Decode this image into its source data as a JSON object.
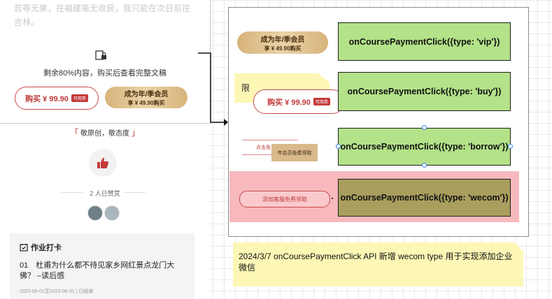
{
  "app": {
    "faded_text": "苦等无果，在福建毫无收获，我只能在次日前往吉林。",
    "remaining_text": "剩余80%内容，购买后查看完整文稿",
    "buy_button": {
      "label": "购买 ¥ 99.90",
      "coupon": "可用券"
    },
    "vip_button": {
      "line1": "成为年/季会员",
      "line2": "享 ¥ 49.90购买"
    },
    "respect_text": "敬原创，敬态度",
    "liked_text": "2 人已赞赏",
    "card": {
      "title": "作业打卡",
      "item": "01　杜甫为什么都不待见家乡网红景点龙门大佛？ –读后感",
      "date": "2023-06-01至2023-06-31 | 已结束"
    }
  },
  "diagram": {
    "rows": [
      {
        "code": "onCoursePaymentClick({type: 'vip'})"
      },
      {
        "code": "onCoursePaymentClick({type: 'buy'})"
      },
      {
        "code": "onCoursePaymentClick({type: 'borrow'})"
      },
      {
        "code": "onCoursePaymentClick({type: 'wecom'})"
      }
    ],
    "vip_thumb": {
      "line1": "成为年/季会员",
      "line2": "享 ¥ 49.90购买"
    },
    "buy_note_text": "限",
    "buy_thumb": {
      "label": "购买 ¥ 99.90",
      "coupon": "可用券"
    },
    "borrow_thumb": {
      "small_label": "点击免",
      "button": "年会员免费领取"
    },
    "wecom_thumb": {
      "label": "添加客服免费领取"
    },
    "note": "2024/3/7  onCoursePaymentClick API 新增 wecom type 用于实现添加企业微信"
  },
  "colors": {
    "code_box": "#b3e289",
    "code_box_highlight": "#a99e5d",
    "highlight_bg": "#f7b9bd",
    "sticky_note": "#fdf7b6",
    "accent_red": "#c33a3a"
  }
}
